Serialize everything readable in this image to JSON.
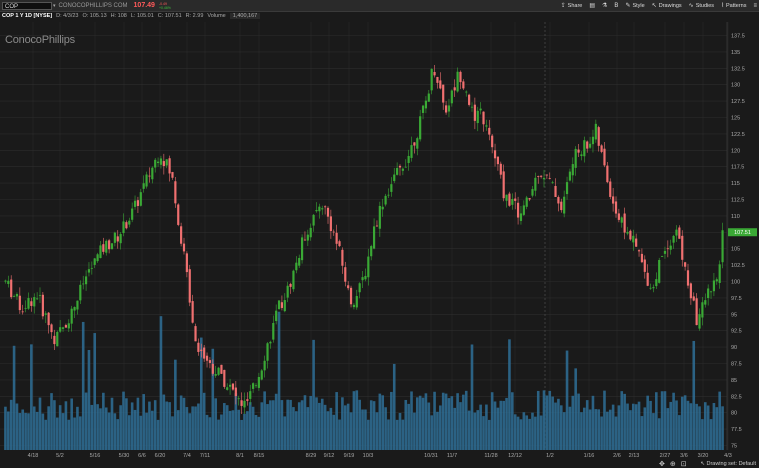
{
  "toolbar": {
    "symbol": "COP",
    "company": "CONOCOPHILLIPS COM",
    "last_price": "107.49",
    "change": "-0.49",
    "change_pct": "+0.46%",
    "items": [
      {
        "icon": "share-icon",
        "label": "Share"
      },
      {
        "icon": "print-icon",
        "label": ""
      },
      {
        "icon": "flask-icon",
        "label": ""
      },
      {
        "icon": "bold-icon",
        "label": "B"
      },
      {
        "icon": "style-icon",
        "label": "Style"
      },
      {
        "icon": "drawings-icon",
        "label": "Drawings"
      },
      {
        "icon": "studies-icon",
        "label": "Studies"
      },
      {
        "icon": "patterns-icon",
        "label": "Patterns"
      }
    ]
  },
  "info": {
    "title": "COP 1 Y 1D [NYSE]",
    "date": "D: 4/3/23",
    "open": "O: 105.13",
    "high": "H: 108",
    "low": "L: 105.01",
    "close": "C: 107.51",
    "range": "R: 2.99",
    "volume_label": "Volume",
    "volume_value": "1,400,167"
  },
  "watermark": "ConocoPhillips",
  "footer": {
    "drawing_set": "Drawing set: Default"
  },
  "colors": {
    "up": "#3aa935",
    "down": "#f07070",
    "volume": "#2d6a90",
    "grid": "#2c2c2c",
    "background": "#1a1a1a",
    "last_price_tag": "#3aa935"
  },
  "chart_data": {
    "type": "candlestick",
    "title": "COP 1 Y 1D [NYSE]",
    "x_tick_labels": [
      "4/18",
      "5/2",
      "5/16",
      "5/30",
      "6/6",
      "6/20",
      "7/4",
      "7/11",
      "8/1",
      "8/15",
      "8/29",
      "9/12",
      "9/19",
      "10/3",
      "10/31",
      "11/7",
      "11/28",
      "12/12",
      "1/2",
      "1/16",
      "2/6",
      "2/13",
      "2/27",
      "3/6",
      "3/20",
      "4/3"
    ],
    "y_tick_labels": [
      "137.5",
      "135",
      "132.5",
      "130",
      "127.5",
      "125",
      "122.5",
      "120",
      "117.5",
      "115",
      "112.5",
      "110",
      "107.5",
      "105",
      "102.5",
      "100",
      "97.5",
      "95",
      "92.5",
      "90",
      "87.5",
      "85",
      "82.5",
      "80",
      "77.5",
      "75"
    ],
    "ylim": [
      74,
      139
    ],
    "last_price": 107.51,
    "last_price_label": "107.51",
    "price_path": [
      [
        0,
        100
      ],
      [
        8,
        96
      ],
      [
        16,
        98
      ],
      [
        25,
        91
      ],
      [
        33,
        95
      ],
      [
        41,
        101
      ],
      [
        49,
        105
      ],
      [
        57,
        107
      ],
      [
        65,
        111
      ],
      [
        72,
        116
      ],
      [
        78,
        120
      ],
      [
        84,
        116
      ],
      [
        88,
        108
      ],
      [
        92,
        100
      ],
      [
        96,
        91
      ],
      [
        100,
        89
      ],
      [
        104,
        87
      ],
      [
        108,
        86
      ],
      [
        113,
        84
      ],
      [
        117,
        82
      ],
      [
        121,
        81
      ],
      [
        126,
        84
      ],
      [
        130,
        88
      ],
      [
        134,
        92
      ],
      [
        138,
        96
      ],
      [
        143,
        99
      ],
      [
        147,
        103
      ],
      [
        151,
        107
      ],
      [
        156,
        110
      ],
      [
        160,
        112
      ],
      [
        165,
        108
      ],
      [
        169,
        104
      ],
      [
        174,
        97
      ],
      [
        178,
        98
      ],
      [
        182,
        102
      ],
      [
        186,
        108
      ],
      [
        190,
        112
      ],
      [
        195,
        115
      ],
      [
        199,
        117
      ],
      [
        203,
        119
      ],
      [
        208,
        123
      ],
      [
        212,
        127
      ],
      [
        216,
        133
      ],
      [
        219,
        130
      ],
      [
        222,
        126
      ],
      [
        226,
        129
      ],
      [
        229,
        132
      ],
      [
        233,
        129
      ],
      [
        237,
        124
      ],
      [
        240,
        126
      ],
      [
        244,
        122
      ],
      [
        248,
        118
      ],
      [
        252,
        113
      ],
      [
        256,
        112
      ],
      [
        260,
        110
      ],
      [
        265,
        113
      ],
      [
        269,
        117
      ],
      [
        273,
        116
      ],
      [
        277,
        114
      ],
      [
        281,
        111
      ],
      [
        285,
        117
      ],
      [
        289,
        120
      ],
      [
        294,
        121
      ],
      [
        298,
        123
      ],
      [
        301,
        119
      ],
      [
        305,
        114
      ],
      [
        309,
        110
      ],
      [
        313,
        108
      ],
      [
        317,
        106
      ],
      [
        320,
        104
      ],
      [
        323,
        101
      ],
      [
        327,
        99
      ],
      [
        331,
        104
      ],
      [
        335,
        106
      ],
      [
        339,
        108
      ],
      [
        342,
        103
      ],
      [
        346,
        98
      ],
      [
        349,
        94
      ],
      [
        353,
        97
      ],
      [
        357,
        100
      ],
      [
        359,
        99
      ],
      [
        362,
        107
      ]
    ],
    "volume_ylim": [
      0,
      100
    ]
  }
}
